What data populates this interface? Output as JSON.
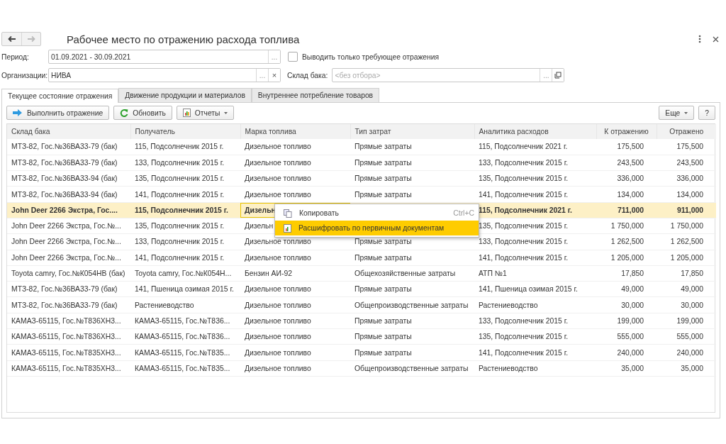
{
  "window": {
    "title": "Рабочее место по отражению расхода топлива",
    "back_disabled": false,
    "forward_disabled": true
  },
  "filters": {
    "period": {
      "label": "Период:",
      "value": "01.09.2021 - 30.09.2021",
      "buttons": [
        "..."
      ]
    },
    "only_required": {
      "label": "Выводить только требующее отражения",
      "checked": false
    },
    "organization": {
      "label": "Организации:",
      "value": "НИВА",
      "buttons": [
        "...",
        "×"
      ]
    },
    "tank_warehouse": {
      "label": "Склад бака:",
      "placeholder": "<без отбора>",
      "buttons": [
        "..."
      ]
    }
  },
  "tabs": [
    {
      "label": "Текущее состояние отражения",
      "selected": true
    },
    {
      "label": "Движение продукции и материалов",
      "selected": false
    },
    {
      "label": "Внутреннее потребление товаров",
      "selected": false
    }
  ],
  "toolbar": {
    "buttons": [
      {
        "label": "Выполнить отражение",
        "kind": "execute"
      },
      {
        "label": "Обновить",
        "kind": "refresh"
      },
      {
        "label": "Отчеты",
        "kind": "reports"
      }
    ],
    "more": "Еще",
    "help": "?"
  },
  "table": {
    "columns": [
      "Склад бака",
      "Получатель",
      "Марка топлива",
      "Тип затрат",
      "Аналитика расходов",
      "К отражению",
      "Отражено"
    ],
    "rows": [
      {
        "selected": false,
        "cells": [
          "МТЗ-82, Гос.№36ВА33-79 (бак)",
          "115, Подсолнечник 2015 г.",
          "Дизельное топливо",
          "Прямые затраты",
          "115, Подсолнечник 2021 г.",
          "175,500",
          "175,500"
        ]
      },
      {
        "selected": false,
        "cells": [
          "МТЗ-82, Гос.№36ВА33-79 (бак)",
          "133, Подсолнечник 2015 г.",
          "Дизельное топливо",
          "Прямые затраты",
          "133, Подсолнечник 2015 г.",
          "243,500",
          "243,500"
        ]
      },
      {
        "selected": false,
        "cells": [
          "МТЗ-82, Гос.№36ВА33-94 (бак)",
          "135, Подсолнечник 2015 г.",
          "Дизельное топливо",
          "Прямые затраты",
          "135, Подсолнечник 2015 г.",
          "336,000",
          "336,000"
        ]
      },
      {
        "selected": false,
        "cells": [
          "МТЗ-82, Гос.№36ВА33-94 (бак)",
          "141, Подсолнечник 2015 г.",
          "Дизельное топливо",
          "Прямые затраты",
          "141, Подсолнечник 2015 г.",
          "134,000",
          "134,000"
        ]
      },
      {
        "selected": true,
        "cells": [
          "John Deer 2266 Экстра, Гос....",
          "115, Подсолнечник 2015 г.",
          {
            "text": "Дизельн",
            "focused": true
          },
          null,
          "115, Подсолнечник 2021 г.",
          "711,000",
          "911,000"
        ]
      },
      {
        "selected": false,
        "cells": [
          "John Deer 2266 Экстра, Гос.№...",
          "135, Подсолнечник 2015 г.",
          "Дизельн",
          null,
          "135, Подсолнечник 2015 г.",
          "1 750,000",
          "1 750,000"
        ]
      },
      {
        "selected": false,
        "cells": [
          "John Deer 2266 Экстра, Гос.№...",
          "133, Подсолнечник 2015 г.",
          "Дизельное топливо",
          "Прямые затраты",
          "133, Подсолнечник 2015 г.",
          "1 262,500",
          "1 262,500"
        ]
      },
      {
        "selected": false,
        "cells": [
          "John Deer 2266 Экстра, Гос.№...",
          "141, Подсолнечник 2015 г.",
          "Дизельное топливо",
          "Прямые затраты",
          "141, Подсолнечник 2015 г.",
          "1 205,000",
          "1 205,000"
        ]
      },
      {
        "selected": false,
        "cells": [
          "Toyota camry, Гос.№К054НВ (бак)",
          "Toyota camry, Гос.№К054Н...",
          "Бензин АИ-92",
          "Общехозяйственные затраты",
          "АТП №1",
          "17,850",
          "17,850"
        ]
      },
      {
        "selected": false,
        "cells": [
          "МТЗ-82, Гос.№36ВА33-79 (бак)",
          "141, Пшеница озимая 2015 г.",
          "Дизельное топливо",
          "Прямые затраты",
          "141, Пшеница озимая 2015 г.",
          "49,000",
          "49,000"
        ]
      },
      {
        "selected": false,
        "cells": [
          "МТЗ-82, Гос.№36ВА33-79 (бак)",
          "Растениеводство",
          "Дизельное топливо",
          "Общепроизводственные затраты",
          "Растениеводство",
          "30,000",
          "30,000"
        ]
      },
      {
        "selected": false,
        "cells": [
          "КАМАЗ-65115, Гос.№Т836ХН3...",
          "КАМАЗ-65115, Гос.№Т836...",
          "Дизельное топливо",
          "Прямые затраты",
          "133, Подсолнечник 2015 г.",
          "199,000",
          "199,000"
        ]
      },
      {
        "selected": false,
        "cells": [
          "КАМАЗ-65115, Гос.№Т836ХН3...",
          "КАМАЗ-65115, Гос.№Т836...",
          "Дизельное топливо",
          "Прямые затраты",
          "135, Подсолнечник 2015 г.",
          "555,000",
          "555,000"
        ]
      },
      {
        "selected": false,
        "cells": [
          "КАМАЗ-65115, Гос.№Т835ХН3...",
          "КАМАЗ-65115, Гос.№Т835...",
          "Дизельное топливо",
          "Прямые затраты",
          "141, Подсолнечник 2015 г.",
          "240,000",
          "240,000"
        ]
      },
      {
        "selected": false,
        "cells": [
          "КАМАЗ-65115, Гос.№Т835ХН3...",
          "КАМАЗ-65115, Гос.№Т835...",
          "Дизельное топливо",
          "Общепроизводственные затраты",
          "Растениеводство",
          "35,000",
          "35,000"
        ]
      }
    ]
  },
  "context_menu": {
    "items": [
      {
        "label": "Копировать",
        "shortcut": "Ctrl+C",
        "kind": "copy",
        "selected": false
      },
      {
        "label": "Расшифровать по первичным документам",
        "kind": "report",
        "selected": true
      }
    ]
  }
}
